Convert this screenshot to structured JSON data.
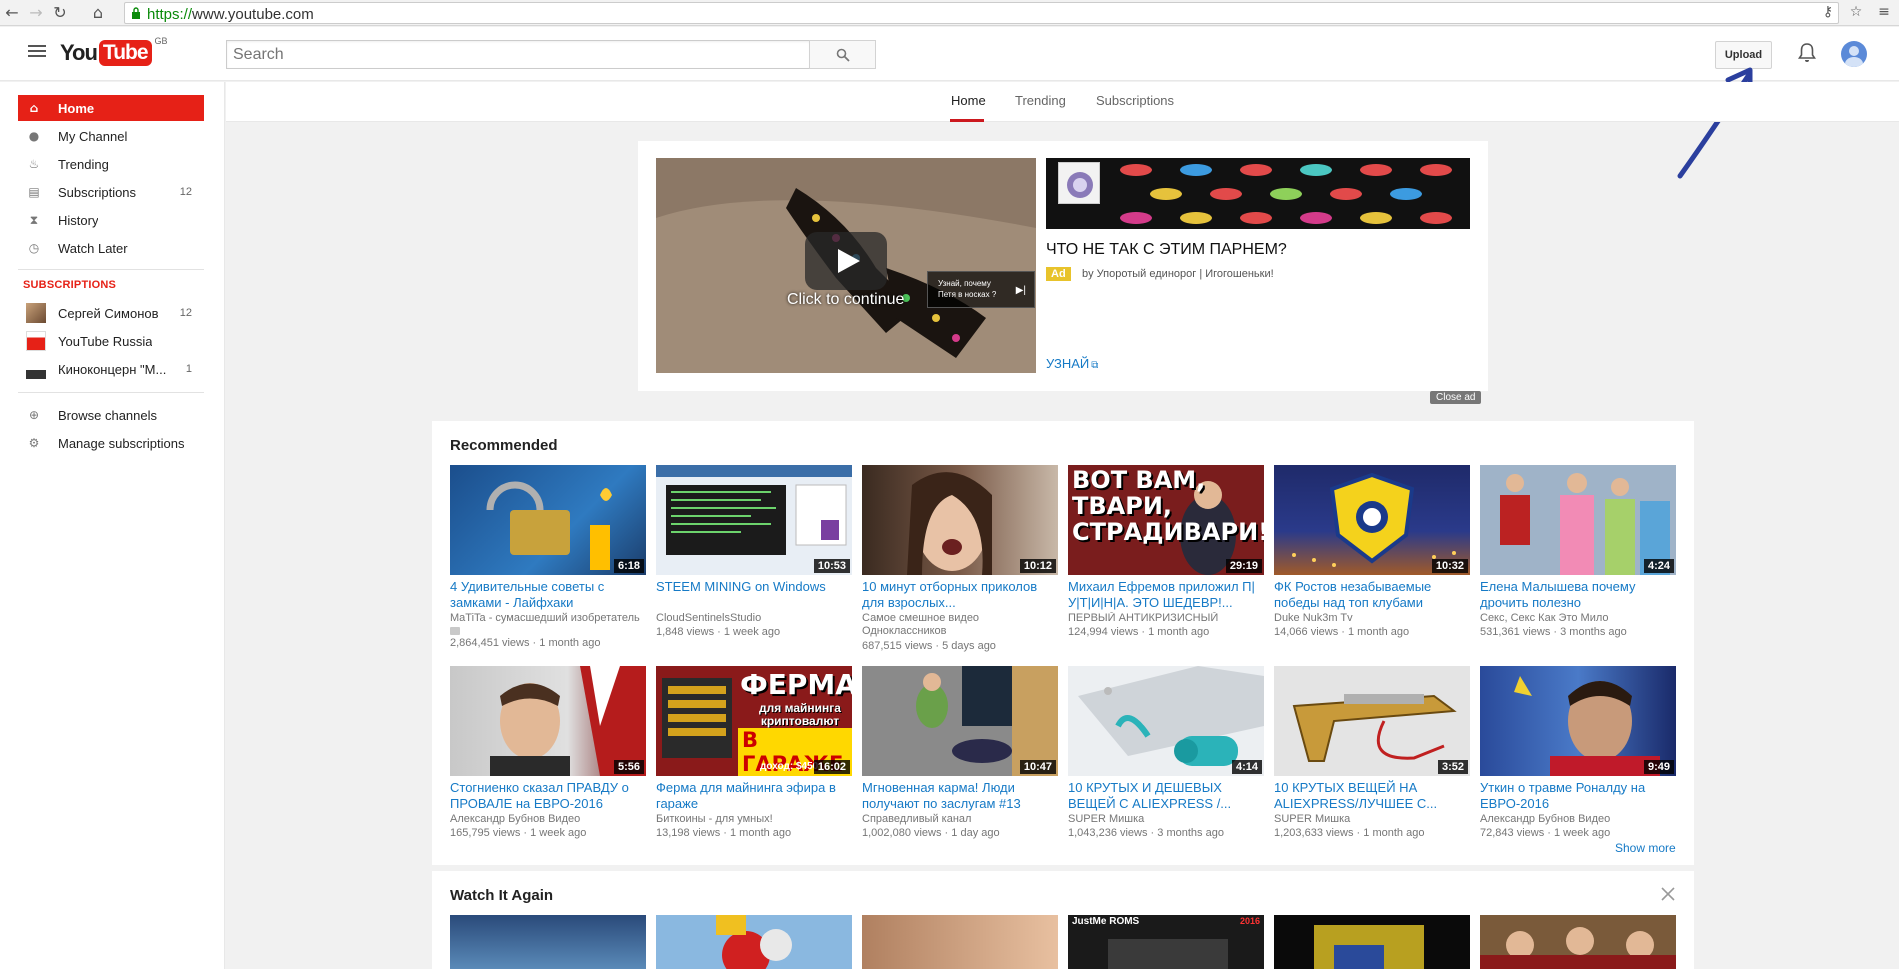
{
  "browser": {
    "url_scheme": "https://",
    "url_rest": "www.youtube.com"
  },
  "masthead": {
    "logo_you": "You",
    "logo_tube": "Tube",
    "logo_region": "GB",
    "search_placeholder": "Search",
    "upload_label": "Upload"
  },
  "sidebar": {
    "items": [
      {
        "label": "Home",
        "count": ""
      },
      {
        "label": "My Channel",
        "count": ""
      },
      {
        "label": "Trending",
        "count": ""
      },
      {
        "label": "Subscriptions",
        "count": "12"
      },
      {
        "label": "History",
        "count": ""
      },
      {
        "label": "Watch Later",
        "count": ""
      }
    ],
    "subscriptions_heading": "SUBSCRIPTIONS",
    "subscriptions": [
      {
        "label": "Сергей Симонов",
        "count": "12"
      },
      {
        "label": "YouTube Russia",
        "count": ""
      },
      {
        "label": "Киноконцерн \"М...",
        "count": "1"
      }
    ],
    "footer": [
      {
        "label": "Browse channels"
      },
      {
        "label": "Manage subscriptions"
      }
    ]
  },
  "tabs": [
    "Home",
    "Trending",
    "Subscriptions"
  ],
  "ad": {
    "continue_text": "Click to continue",
    "skip_line1": "Узнай, почему",
    "skip_line2": "Петя в носках ?",
    "title": "ЧТО НЕ ТАК С ЭТИМ ПАРНЕМ?",
    "badge": "Ad",
    "by": "by Упоротый единорог | Игогошеньки!",
    "link": "УЗНАЙ",
    "close": "Close ad"
  },
  "recommended": {
    "title": "Recommended",
    "show_more": "Show more",
    "videos": [
      {
        "title": "4 Удивительные советы с замками - Лайфхаки",
        "channel": "MaTiTa - сумасшедший изобретатель",
        "views": "2,864,451 views",
        "age": "1 month ago",
        "duration": "6:18"
      },
      {
        "title": "STEEM MINING on Windows",
        "channel": "CloudSentinelsStudio",
        "views": "1,848 views",
        "age": "1 week ago",
        "duration": "10:53"
      },
      {
        "title": "10 минут отборных приколов для взрослых...",
        "channel": "Самое смешное видео Одноклассников",
        "views": "687,515 views",
        "age": "5 days ago",
        "duration": "10:12"
      },
      {
        "title": "Михаил Ефремов приложил П|У|Т|И|Н|А. ЭТО ШЕДЕВР!...",
        "channel": "ПЕРВЫЙ АНТИКРИЗИСНЫЙ",
        "views": "124,994 views",
        "age": "1 month ago",
        "duration": "29:19"
      },
      {
        "title": "ФК Ростов незабываемые победы над топ клубами",
        "channel": "Duke Nuk3m Tv",
        "views": "14,066 views",
        "age": "1 month ago",
        "duration": "10:32"
      },
      {
        "title": "Елена Малышева почему дрочить полезно",
        "channel": "Секс, Секс Как Это Мило",
        "views": "531,361 views",
        "age": "3 months ago",
        "duration": "4:24"
      },
      {
        "title": "Стогниенко сказал ПРАВДУ о ПРОВАЛЕ на ЕВРО-2016",
        "channel": "Александр Бубнов Видео",
        "views": "165,795 views",
        "age": "1 week ago",
        "duration": "5:56"
      },
      {
        "title": "Ферма для майнинга эфира в гараже",
        "channel": "Биткоины - для умных!",
        "views": "13,198 views",
        "age": "1 month ago",
        "duration": "16:02"
      },
      {
        "title": "Мгновенная карма! Люди получают по заслугам #13",
        "channel": "Справедливый канал",
        "views": "1,002,080 views",
        "age": "1 day ago",
        "duration": "10:47"
      },
      {
        "title": "10 КРУТЫХ И ДЕШЕВЫХ ВЕЩЕЙ С ALIEXPRESS /...",
        "channel": "SUPER Мишка",
        "views": "1,043,236 views",
        "age": "3 months ago",
        "duration": "4:14"
      },
      {
        "title": "10 КРУТЫХ ВЕЩЕЙ НА ALIEXPRESS/ЛУЧШЕЕ С...",
        "channel": "SUPER Мишка",
        "views": "1,203,633 views",
        "age": "1 month ago",
        "duration": "3:52"
      },
      {
        "title": "Уткин о травме Роналду на ЕВРО-2016",
        "channel": "Александр Бубнов Видео",
        "views": "72,843 views",
        "age": "1 week ago",
        "duration": "9:49"
      }
    ],
    "thumb_text": {
      "t4": "ВОТ ВАМ, ТВАРИ, СТРАДИВАРИ!",
      "t8_a": "ФЕРМА",
      "t8_b": "для майнинга криптовалют",
      "t8_c": "В ГАРАЖЕ",
      "t8_d": "доход: $450"
    }
  },
  "watch_again": {
    "title": "Watch It Again",
    "thumb_text_4": "JustMe ROMS",
    "thumb_text_4b": "2016"
  },
  "colors": {
    "brand_red": "#e62117",
    "link_blue": "#167ac6",
    "ad_yellow": "#e8c32b",
    "annotation_arrow": "#2b3f9e"
  }
}
